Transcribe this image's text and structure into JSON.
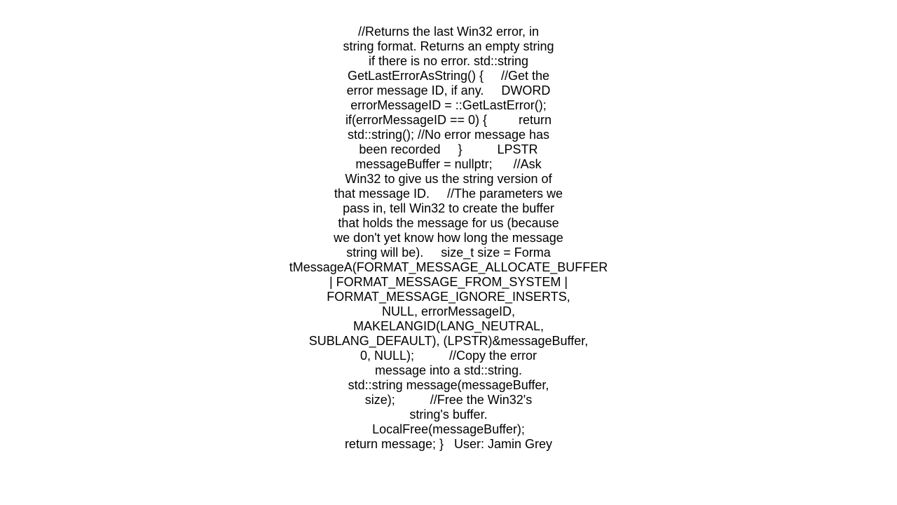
{
  "document": {
    "lines": [
      "//Returns the last Win32 error, in",
      "string format. Returns an empty string",
      "if there is no error. std::string",
      "GetLastErrorAsString() {     //Get the",
      "error message ID, if any.     DWORD",
      "errorMessageID = ::GetLastError();",
      "if(errorMessageID == 0) {         return",
      "std::string(); //No error message has",
      "been recorded     }          LPSTR",
      "messageBuffer = nullptr;      //Ask",
      "Win32 to give us the string version of",
      "that message ID.     //The parameters we",
      "pass in, tell Win32 to create the buffer",
      "that holds the message for us (because",
      "we don't yet know how long the message",
      "string will be).     size_t size = Forma",
      "tMessageA(FORMAT_MESSAGE_ALLOCATE_BUFFER",
      "| FORMAT_MESSAGE_FROM_SYSTEM |",
      "FORMAT_MESSAGE_IGNORE_INSERTS,",
      "NULL, errorMessageID,",
      "MAKELANGID(LANG_NEUTRAL,",
      "SUBLANG_DEFAULT), (LPSTR)&messageBuffer,",
      "0, NULL);          //Copy the error",
      "message into a std::string.",
      "std::string message(messageBuffer,",
      "size);          //Free the Win32's",
      "string's buffer.",
      "LocalFree(messageBuffer);",
      "return message; }   User: Jamin Grey"
    ]
  }
}
